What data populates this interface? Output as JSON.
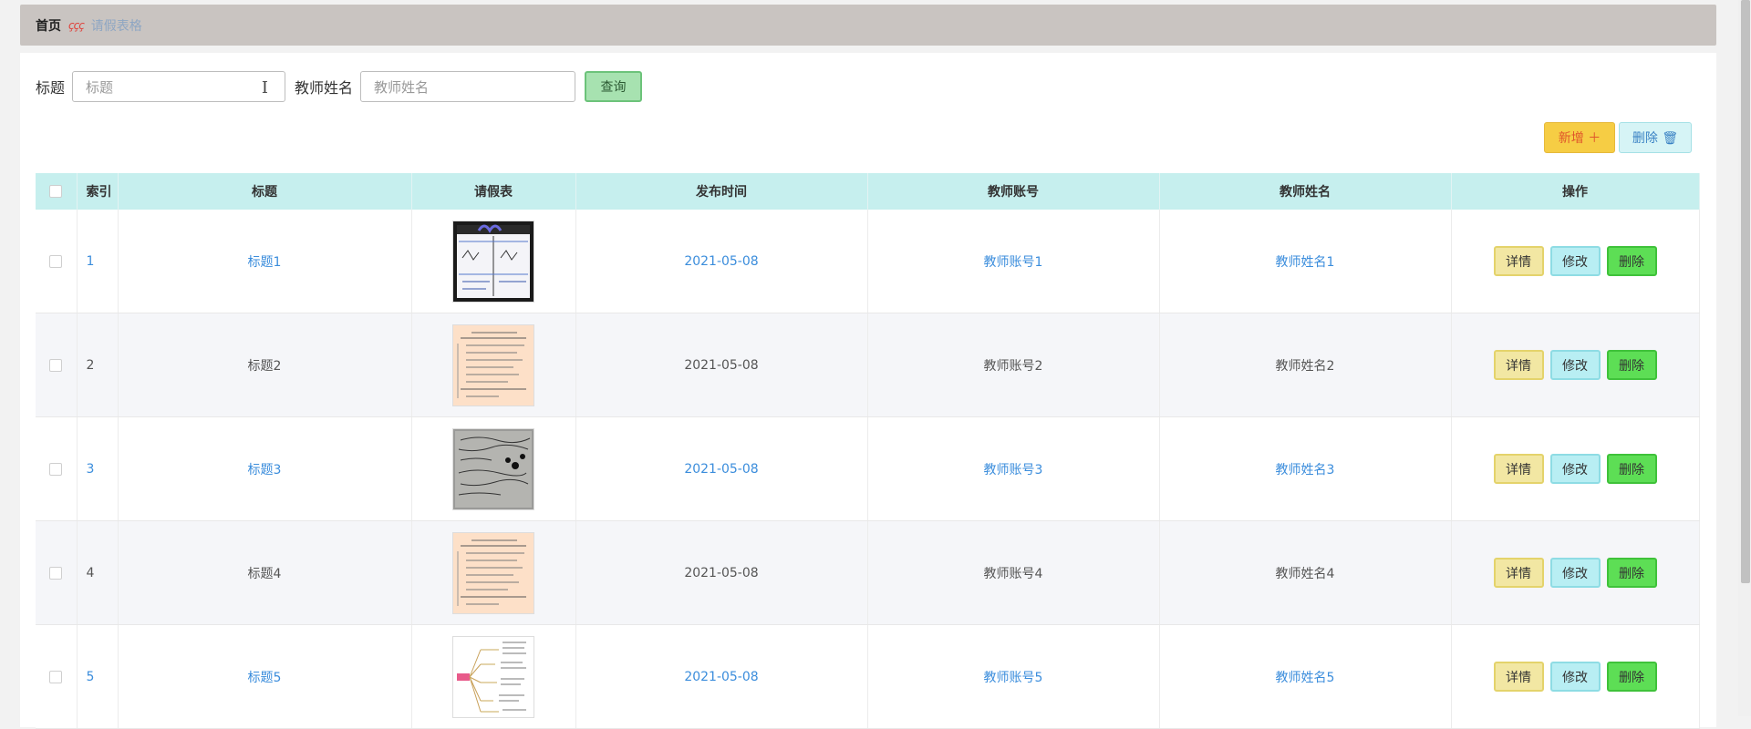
{
  "breadcrumb": {
    "home": "首页",
    "separator": "ççç",
    "current": "请假表格"
  },
  "search": {
    "title_label": "标题",
    "title_placeholder": "标题",
    "teacher_label": "教师姓名",
    "teacher_placeholder": "教师姓名",
    "query_label": "查询"
  },
  "toolbar": {
    "add_label": "新增 ＋",
    "delete_label": "删除 🗑"
  },
  "table": {
    "headers": [
      "索引",
      "标题",
      "请假表",
      "发布时间",
      "教师账号",
      "教师姓名",
      "操作"
    ],
    "rows": [
      {
        "index": "1",
        "title": "标题1",
        "date": "2021-05-08",
        "account": "教师账号1",
        "name": "教师姓名1",
        "image": "whiteboard-photo"
      },
      {
        "index": "2",
        "title": "标题2",
        "date": "2021-05-08",
        "account": "教师账号2",
        "name": "教师姓名2",
        "image": "document-scan"
      },
      {
        "index": "3",
        "title": "标题3",
        "date": "2021-05-08",
        "account": "教师账号3",
        "name": "教师姓名3",
        "image": "handwritten-notes"
      },
      {
        "index": "4",
        "title": "标题4",
        "date": "2021-05-08",
        "account": "教师账号4",
        "name": "教师姓名4",
        "image": "document-scan"
      },
      {
        "index": "5",
        "title": "标题5",
        "date": "2021-05-08",
        "account": "教师账号5",
        "name": "教师姓名5",
        "image": "mind-map"
      }
    ],
    "row_actions": {
      "detail": "详情",
      "edit": "修改",
      "delete": "删除"
    }
  },
  "colors": {
    "header_bg": "#c6efee",
    "link": "#3b8ddc",
    "detail_btn": "#f2e7a3",
    "edit_btn": "#b8eef3",
    "delete_btn": "#5dde55",
    "add_btn": "#f6cd44"
  }
}
